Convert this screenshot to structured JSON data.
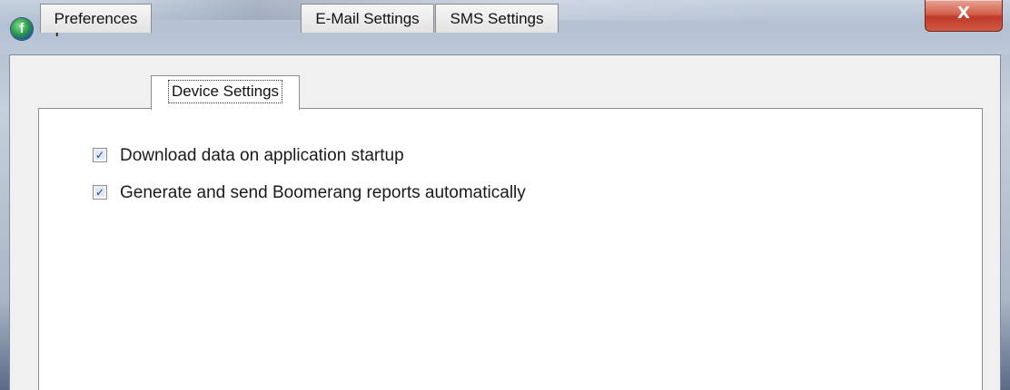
{
  "window": {
    "title": "Options",
    "close_glyph": "X",
    "app_icon": "app-logo-icon"
  },
  "tabs": [
    {
      "label": "Preferences",
      "active": false
    },
    {
      "label": "Device Settings",
      "active": true
    },
    {
      "label": "E-Mail Settings",
      "active": false
    },
    {
      "label": "SMS Settings",
      "active": false
    }
  ],
  "device_settings": {
    "options": [
      {
        "label": "Download data on application startup",
        "checked": true
      },
      {
        "label": "Generate and send Boomerang reports automatically",
        "checked": true
      }
    ]
  },
  "colors": {
    "check_mark": "#1c3f93",
    "close_button": "#c0392b"
  }
}
